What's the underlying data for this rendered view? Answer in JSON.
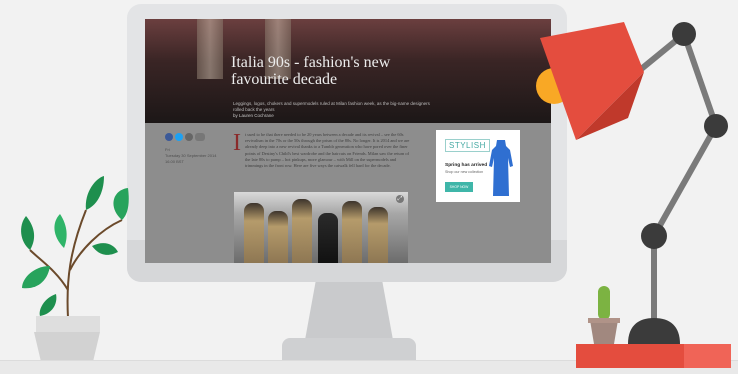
{
  "article": {
    "title": "Italia 90s - fashion's new favourite decade",
    "standfirst": "Leggings, logos, chokers and supermodels ruled at Milan fashion week, as the big-name designers rolled back the years",
    "byline": "by Lauren Cochrane",
    "meta": "Fri\nTuesday 30 September 2014 16.00 BST",
    "dropcap": "I",
    "body": "t used to be that there needed to be 20 years between a decade and its revival – see the 60s revivalism in the 70s or the 50s through the prism of the 80s. No longer. It is 2014 and we are already deep into a new revival thanks to a Tumblr generation who have pored over the finer points of Destiny's Child's best wardrobe and the haircuts on Friends. Milan saw the return of the late 80s to pump – hot pinkups, more glamour – with Mill on the supermodels and trimmings in the front row. Here are five ways the catwalk fell hard for the decade.",
    "expand_icon": "expand-icon"
  },
  "ad": {
    "logo": "STYLISH",
    "title": "Spring has arrived",
    "subtitle": "Shop our new collection",
    "button": "SHOP NOW"
  },
  "colors": {
    "lamp": "#e44d3e",
    "lamp_joint": "#3b3b3b",
    "bulb": "#f9a825",
    "dress": "#2f6fd1",
    "ad_accent": "#3fb6a9"
  }
}
